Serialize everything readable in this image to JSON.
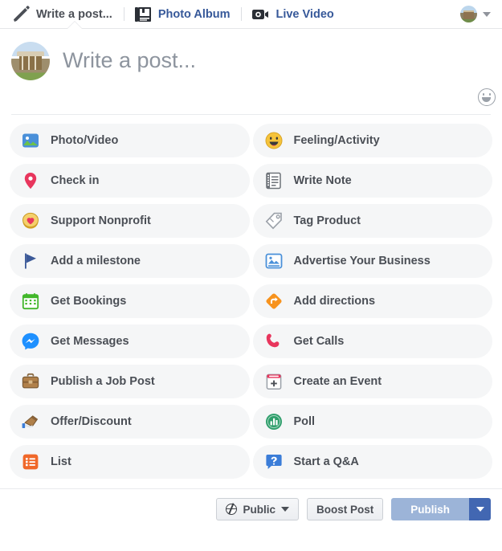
{
  "tabbar": {
    "tabs": [
      {
        "label": "Write a post...",
        "icon": "pencil-icon",
        "active": true
      },
      {
        "label": "Photo Album",
        "icon": "photo-album-icon",
        "active": false
      },
      {
        "label": "Live Video",
        "icon": "live-video-icon",
        "active": false
      }
    ],
    "account_avatar": "user-avatar",
    "account_caret": "chevron-down-icon"
  },
  "composer": {
    "avatar": "page-avatar",
    "placeholder": "Write a post...",
    "value": "",
    "emoji_button": "emoji-smiley-icon"
  },
  "options": [
    {
      "label": "Photo/Video",
      "icon": "photo-video-icon",
      "color": "#4a90d9"
    },
    {
      "label": "Feeling/Activity",
      "icon": "feeling-activity-icon",
      "color": "#f5c33b"
    },
    {
      "label": "Check in",
      "icon": "check-in-pin-icon",
      "color": "#e8365d"
    },
    {
      "label": "Write Note",
      "icon": "write-note-icon",
      "color": "#6d7278"
    },
    {
      "label": "Support Nonprofit",
      "icon": "support-nonprofit-icon",
      "color": "#f0c14b"
    },
    {
      "label": "Tag Product",
      "icon": "tag-product-icon",
      "color": "#9aa0a8"
    },
    {
      "label": "Add a milestone",
      "icon": "milestone-flag-icon",
      "color": "#3b5998"
    },
    {
      "label": "Advertise Your Business",
      "icon": "advertise-icon",
      "color": "#4a90d9"
    },
    {
      "label": "Get Bookings",
      "icon": "get-bookings-icon",
      "color": "#42b72a"
    },
    {
      "label": "Add directions",
      "icon": "add-directions-icon",
      "color": "#f7931e"
    },
    {
      "label": "Get Messages",
      "icon": "messenger-icon",
      "color": "#1e90ff"
    },
    {
      "label": "Get Calls",
      "icon": "phone-call-icon",
      "color": "#e8365d"
    },
    {
      "label": "Publish a Job Post",
      "icon": "briefcase-icon",
      "color": "#a0784a"
    },
    {
      "label": "Create an Event",
      "icon": "create-event-icon",
      "color": "#e8365d"
    },
    {
      "label": "Offer/Discount",
      "icon": "offer-discount-icon",
      "color": "#a0784a"
    },
    {
      "label": "Poll",
      "icon": "poll-icon",
      "color": "#2e9e6b"
    },
    {
      "label": "List",
      "icon": "list-icon",
      "color": "#f0682a"
    },
    {
      "label": "Start a Q&A",
      "icon": "qa-bubble-icon",
      "color": "#3b7dd8"
    }
  ],
  "footer": {
    "privacy_label": "Public",
    "privacy_icon": "globe-icon",
    "boost_label": "Boost Post",
    "publish_label": "Publish",
    "publish_disabled": true,
    "publish_caret": "chevron-down-icon"
  },
  "colors": {
    "facebook_blue": "#4267b2",
    "link_blue": "#365899",
    "publish_disabled": "#9cb4d8",
    "row_bg": "#f5f6f7",
    "text": "#4b4f56"
  }
}
